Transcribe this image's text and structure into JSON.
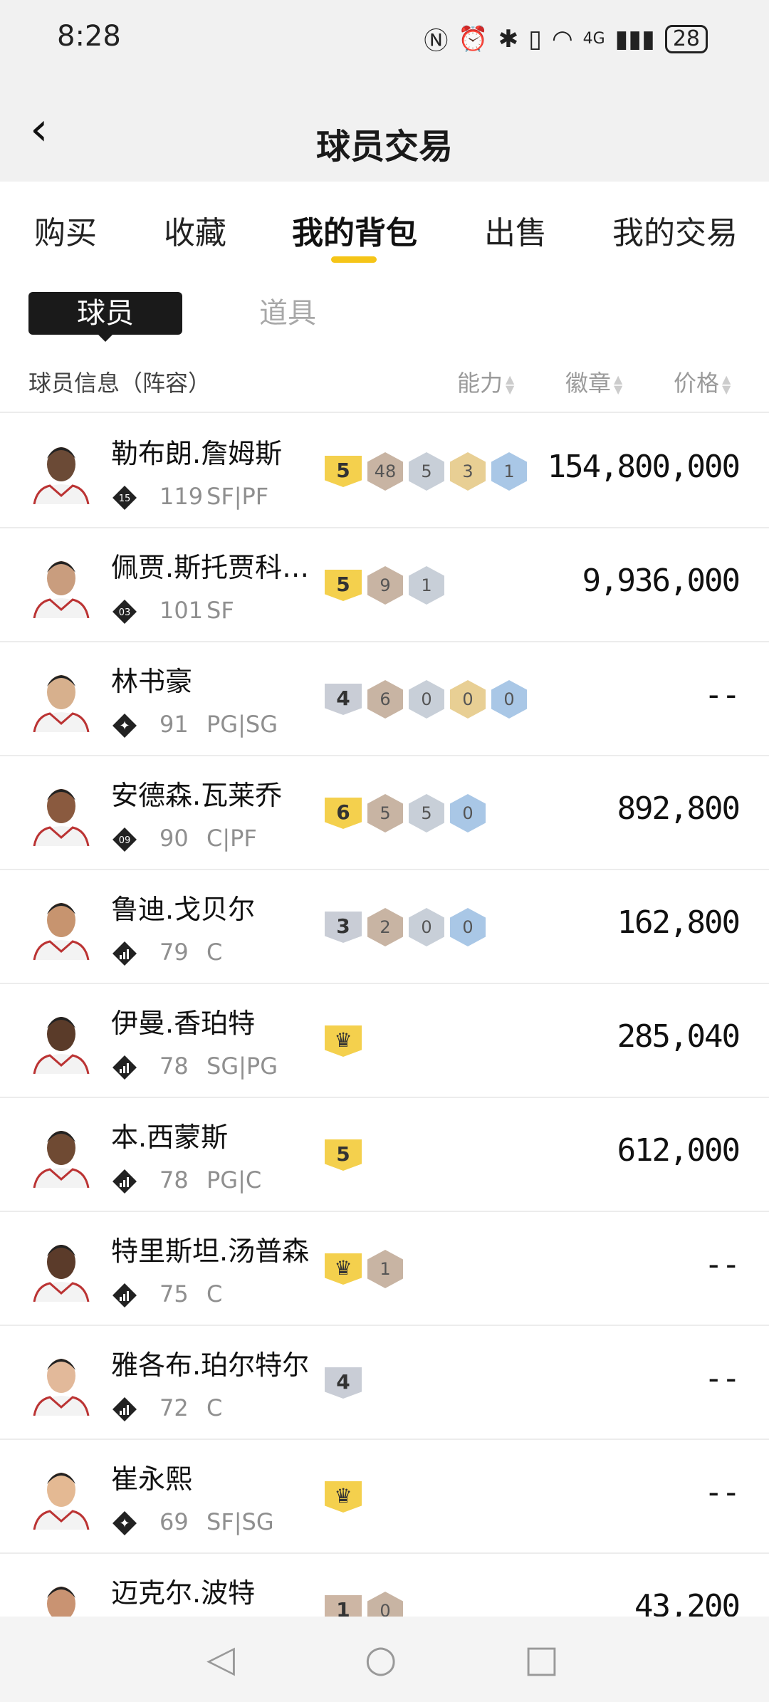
{
  "status": {
    "time": "8:28",
    "battery": "28",
    "network": "4G"
  },
  "header": {
    "title": "球员交易"
  },
  "tabs": [
    "购买",
    "收藏",
    "我的背包",
    "出售",
    "我的交易"
  ],
  "active_tab": "我的背包",
  "segments": {
    "active": "球员",
    "inactive": "道具"
  },
  "columns": {
    "info": "球员信息（阵容）",
    "ability": "能力",
    "badge": "徽章",
    "price": "价格"
  },
  "rows": [
    {
      "name": "勒布朗.詹姆斯",
      "rank": "15",
      "rating": "119",
      "pos": "SF|PF",
      "ability": {
        "kind": "gold",
        "value": "5"
      },
      "badges": [
        {
          "tier": "bronze",
          "v": "48"
        },
        {
          "tier": "silver",
          "v": "5"
        },
        {
          "tier": "gold",
          "v": "3"
        },
        {
          "tier": "blue",
          "v": "1"
        }
      ],
      "price": "154,800,000"
    },
    {
      "name": "佩贾.斯托贾科…",
      "rank": "03",
      "rating": "101",
      "pos": "SF",
      "ability": {
        "kind": "gold",
        "value": "5"
      },
      "badges": [
        {
          "tier": "bronze",
          "v": "9"
        },
        {
          "tier": "silver",
          "v": "1"
        }
      ],
      "price": "9,936,000"
    },
    {
      "name": "林书豪",
      "rank": "star",
      "rating": "91",
      "pos": "PG|SG",
      "ability": {
        "kind": "silver",
        "value": "4"
      },
      "badges": [
        {
          "tier": "bronze",
          "v": "6"
        },
        {
          "tier": "silver",
          "v": "0"
        },
        {
          "tier": "gold",
          "v": "0"
        },
        {
          "tier": "blue",
          "v": "0"
        }
      ],
      "price": "--"
    },
    {
      "name": "安德森.瓦莱乔",
      "rank": "09",
      "rating": "90",
      "pos": "C|PF",
      "ability": {
        "kind": "gold",
        "value": "6"
      },
      "badges": [
        {
          "tier": "bronze",
          "v": "5"
        },
        {
          "tier": "silver",
          "v": "5"
        },
        {
          "tier": "blue",
          "v": "0"
        }
      ],
      "price": "892,800"
    },
    {
      "name": "鲁迪.戈贝尔",
      "rank": "bars",
      "rating": "79",
      "pos": "C",
      "ability": {
        "kind": "silver",
        "value": "3"
      },
      "badges": [
        {
          "tier": "bronze",
          "v": "2"
        },
        {
          "tier": "silver",
          "v": "0"
        },
        {
          "tier": "blue",
          "v": "0"
        }
      ],
      "price": "162,800"
    },
    {
      "name": "伊曼.香珀特",
      "rank": "bars",
      "rating": "78",
      "pos": "SG|PG",
      "ability": {
        "kind": "gold",
        "value": "crown"
      },
      "badges": [],
      "price": "285,040"
    },
    {
      "name": "本.西蒙斯",
      "rank": "bars",
      "rating": "78",
      "pos": "PG|C",
      "ability": {
        "kind": "gold",
        "value": "5"
      },
      "badges": [],
      "price": "612,000"
    },
    {
      "name": "特里斯坦.汤普森",
      "rank": "bars",
      "rating": "75",
      "pos": "C",
      "ability": {
        "kind": "gold",
        "value": "crown"
      },
      "badges": [
        {
          "tier": "bronze",
          "v": "1"
        }
      ],
      "price": "--"
    },
    {
      "name": "雅各布.珀尔特尔",
      "rank": "bars",
      "rating": "72",
      "pos": "C",
      "ability": {
        "kind": "silver",
        "value": "4"
      },
      "badges": [],
      "price": "--"
    },
    {
      "name": "崔永熙",
      "rank": "star",
      "rating": "69",
      "pos": "SF|SG",
      "ability": {
        "kind": "gold",
        "value": "crown"
      },
      "badges": [],
      "price": "--"
    },
    {
      "name": "迈克尔.波特",
      "rank": "bars",
      "rating": "",
      "pos": "",
      "ability": {
        "kind": "bronze",
        "value": "1"
      },
      "badges": [
        {
          "tier": "bronze",
          "v": "0"
        }
      ],
      "price": "43,200"
    }
  ],
  "colors": {
    "accent": "#f5c518",
    "dark": "#1a1a1a"
  },
  "icons": {
    "back": "chevron-left-icon",
    "sort": "sort-arrows-icon",
    "nav": [
      "back-triangle-icon",
      "home-circle-icon",
      "recents-square-icon"
    ]
  }
}
